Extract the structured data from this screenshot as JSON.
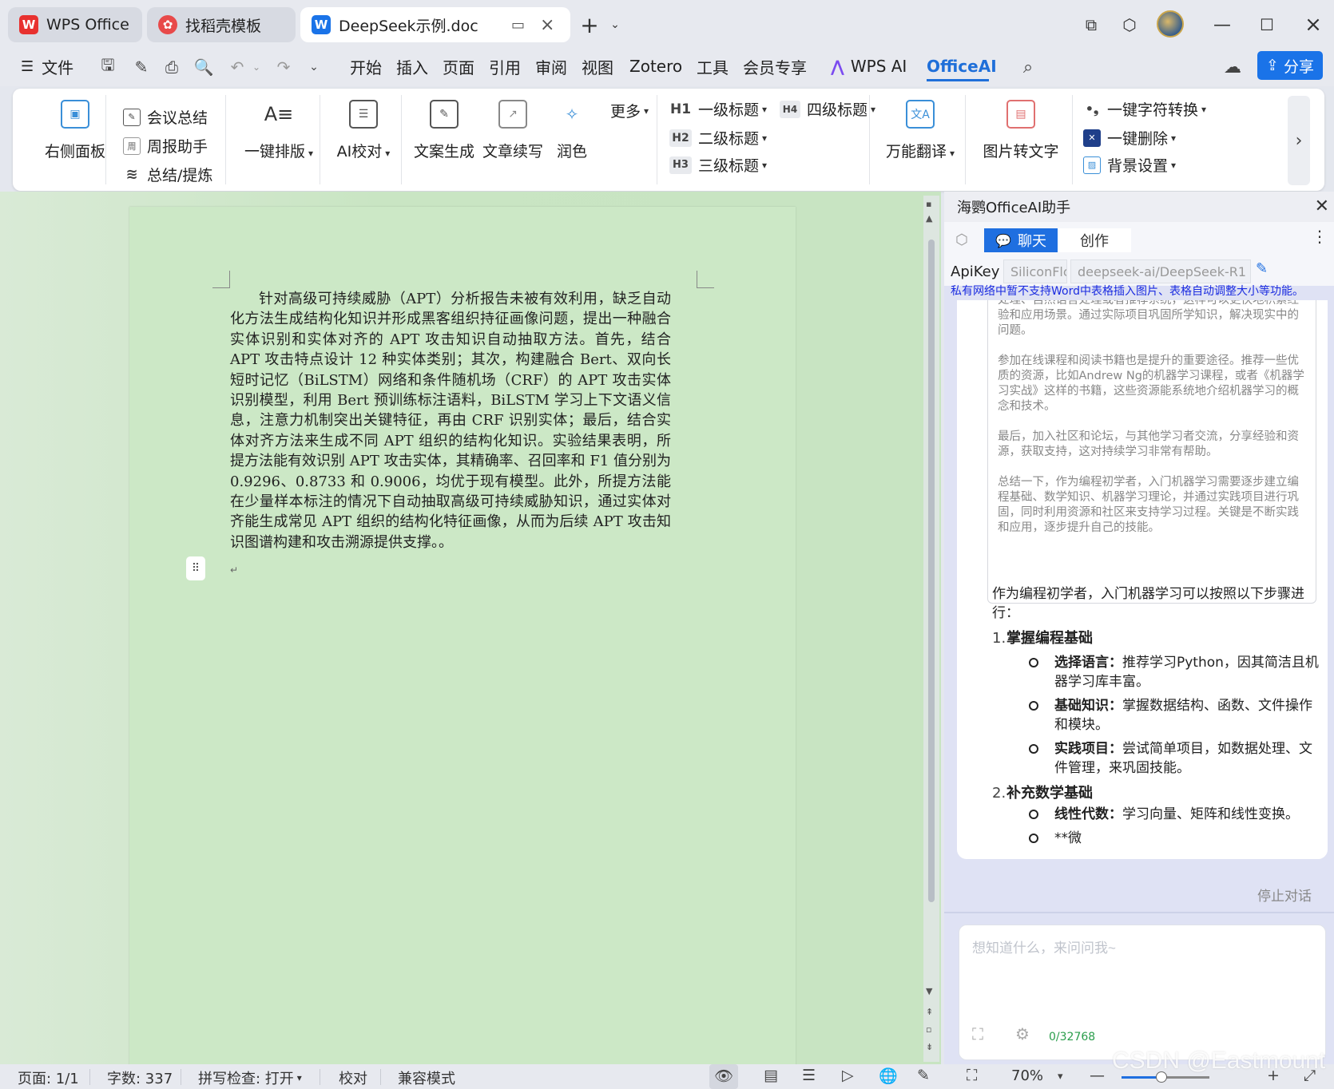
{
  "tabs": [
    {
      "label": "WPS Office",
      "icon": "wps-logo-icon",
      "color": "#e8312f"
    },
    {
      "label": "找稻壳模板",
      "icon": "docer-logo-icon",
      "color": "#e84a4a"
    },
    {
      "label": "DeepSeek示例.doc",
      "icon": "word-doc-icon",
      "color": "#1a73e8"
    }
  ],
  "menu": {
    "file": "文件",
    "items": [
      "开始",
      "插入",
      "页面",
      "引用",
      "审阅",
      "视图",
      "Zotero",
      "工具",
      "会员专享"
    ],
    "wps_ai": "WPS AI",
    "office_ai": "OfficeAI",
    "share": "分享"
  },
  "ribbon": {
    "right_panel": "右侧面板",
    "meeting_summary": "会议总结",
    "weekly_report": "周报助手",
    "summarize": "总结/提炼",
    "one_click_layout": "一键排版",
    "ai_proofread": "AI校对",
    "copy_generate": "文案生成",
    "continue_write": "文章续写",
    "polish": "润色",
    "more": "更多",
    "h1": "一级标题",
    "h2": "二级标题",
    "h3": "三级标题",
    "h4": "四级标题",
    "h1_tag": "H1",
    "h2_tag": "H2",
    "h3_tag": "H3",
    "h4_tag": "H4",
    "translate": "万能翻译",
    "img_to_text": "图片转文字",
    "char_convert": "一键字符转换",
    "one_click_delete": "一键删除",
    "background": "背景设置"
  },
  "document": {
    "paragraph": "针对高级可持续威胁（APT）分析报告未被有效利用，缺乏自动化方法生成结构化知识并形成黑客组织持征画像问题，提出一种融合实体识别和实体对齐的 APT 攻击知识自动抽取方法。首先，结合 APT 攻击特点设计 12 种实体类别；其次，构建融合 Bert、双向长短时记忆（BiLSTM）网络和条件随机场（CRF）的 APT 攻击实体识别模型，利用 Bert 预训练标注语料，BiLSTM 学习上下文语义信息，注意力机制突出关键特征，再由 CRF 识别实体；最后，结合实体对齐方法来生成不同 APT 组织的结构化知识。实验结果表明，所提方法能有效识别 APT 攻击实体，其精确率、召回率和 F1 值分别为 0.9296、0.8733 和 0.9006，均优于现有模型。此外，所提方法能在少量样本标注的情况下自动抽取高级可持续威胁知识，通过实体对齐能生成常见 APT 组织的结构化特征画像，从而为后续 APT 攻击知识图谱构建和攻击溯源提供支撑。。",
    "para_mark": "↵"
  },
  "panel": {
    "title": "海鹦OfficeAI助手",
    "tab_chat": "聊天",
    "tab_create": "创作",
    "apikey_label": "ApiKey",
    "provider": "SiliconFlc",
    "model": "deepseek-ai/DeepSeek-R1",
    "notice": "私有网络中暂不支持Word中表格插入图片、表格自动调整大小等功能。",
    "quote": [
      "处理、自然语言处理或者推荐系统，这样可以更快地积累经验和应用场景。通过实际项目巩固所学知识，解决现实中的问题。",
      "参加在线课程和阅读书籍也是提升的重要途径。推荐一些优质的资源，比如Andrew Ng的机器学习课程，或者《机器学习实战》这样的书籍，这些资源能系统地介绍机器学习的概念和技术。",
      "最后，加入社区和论坛，与其他学习者交流，分享经验和资源，获取支持，这对持续学习非常有帮助。",
      "总结一下，作为编程初学者，入门机器学习需要逐步建立编程基础、数学知识、机器学习理论，并通过实践项目进行巩固，同时利用资源和社区来支持学习过程。关键是不断实践和应用，逐步提升自己的技能。"
    ],
    "answer_intro": "作为编程初学者，入门机器学习可以按照以下步骤进行：",
    "sections": [
      {
        "num": "1.",
        "title": "掌握编程基础",
        "items": [
          {
            "label": "选择语言：",
            "text": "推荐学习Python，因其简洁且机器学习库丰富。"
          },
          {
            "label": "基础知识：",
            "text": "掌握数据结构、函数、文件操作和模块。"
          },
          {
            "label": "实践项目：",
            "text": "尝试简单项目，如数据处理、文件管理，来巩固技能。"
          }
        ]
      },
      {
        "num": "2.",
        "title": "补充数学基础",
        "items": [
          {
            "label": "线性代数：",
            "text": "学习向量、矩阵和线性变换。"
          },
          {
            "label": "",
            "text": "**微"
          }
        ]
      }
    ],
    "stop": "停止对话",
    "input_placeholder": "想知道什么，来问问我~",
    "counter": "0/32768"
  },
  "status": {
    "page": "页面: 1/1",
    "words": "字数: 337",
    "spell": "拼写检查: 打开",
    "proof": "校对",
    "compat": "兼容模式",
    "zoom": "70%",
    "zoom_level": 0.45
  },
  "watermark": "CSDN @Eastmount",
  "colors": {
    "accent": "#1f6fe0",
    "doc_background": "#cce8c6",
    "notice_text": "#1a2be0",
    "counter_text": "#2a9d4b"
  }
}
